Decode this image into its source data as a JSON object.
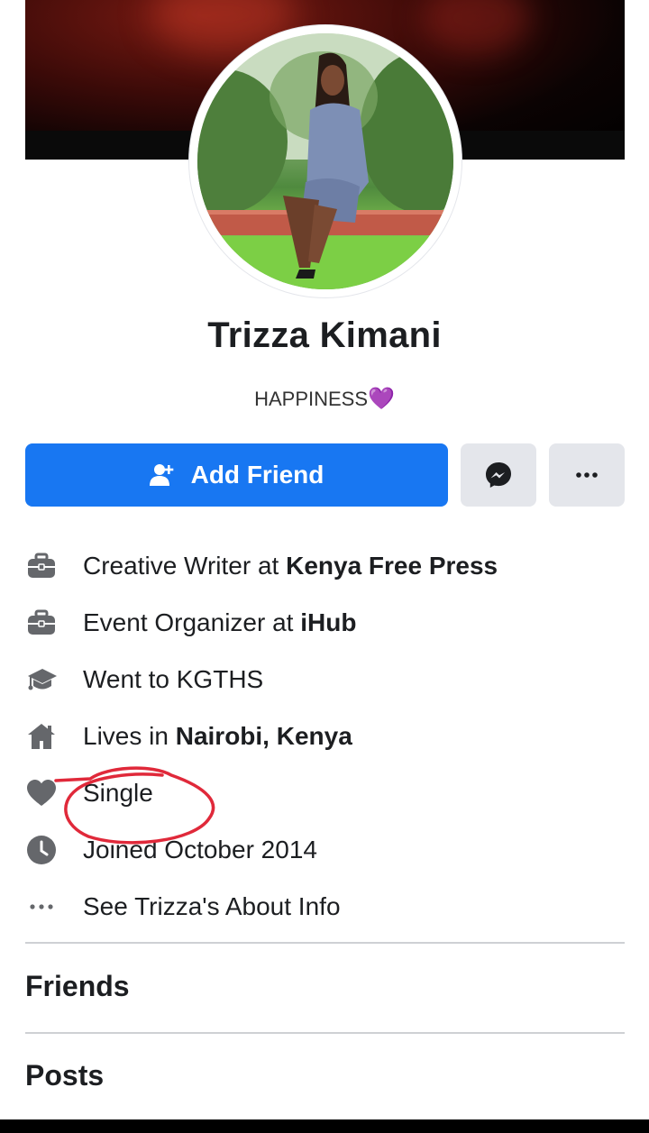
{
  "profile": {
    "name": "Trizza Kimani",
    "bio_text": "HAPPINESS",
    "bio_emoji": "💜"
  },
  "actions": {
    "add_friend_label": "Add Friend",
    "message_icon": "messenger-icon",
    "more_icon": "more-dots-icon"
  },
  "intro": {
    "items": [
      {
        "icon": "briefcase-icon",
        "prefix": "Creative Writer at ",
        "bold": "Kenya Free Press"
      },
      {
        "icon": "briefcase-icon",
        "prefix": "Event Organizer at ",
        "bold": "iHub"
      },
      {
        "icon": "graduation-cap-icon",
        "prefix": "Went to KGTHS",
        "bold": ""
      },
      {
        "icon": "home-icon",
        "prefix": "Lives in ",
        "bold": "Nairobi, Kenya"
      },
      {
        "icon": "heart-icon",
        "prefix": "Single",
        "bold": ""
      },
      {
        "icon": "clock-icon",
        "prefix": "Joined October 2014",
        "bold": ""
      },
      {
        "icon": "more-dots-icon",
        "prefix": "See Trizza's About Info",
        "bold": ""
      }
    ]
  },
  "sections": {
    "friends_title": "Friends",
    "posts_title": "Posts"
  },
  "colors": {
    "primary": "#1877f2",
    "secondary_button": "#e4e6eb",
    "icon_gray": "#65676b",
    "annotation_red": "#e0293a"
  }
}
